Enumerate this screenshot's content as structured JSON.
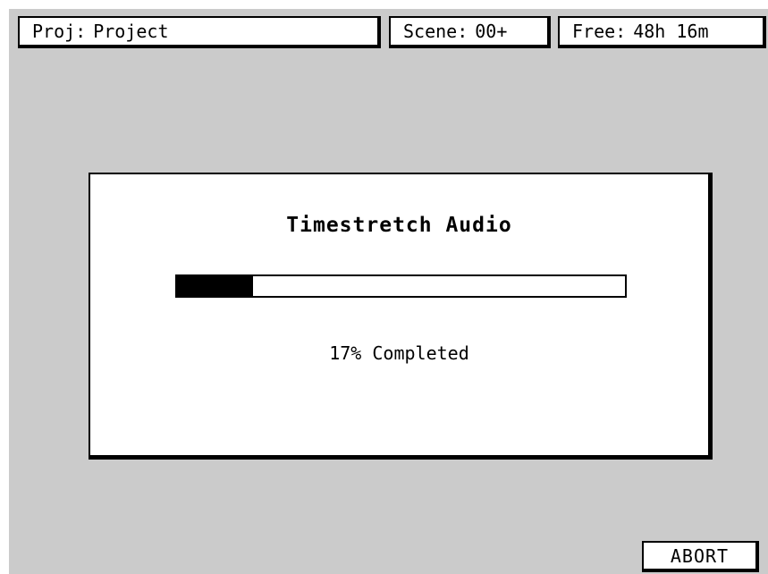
{
  "status": {
    "project": {
      "label": "Proj:",
      "value": "Project"
    },
    "scene": {
      "label": "Scene:",
      "value": "00+"
    },
    "free": {
      "label": "Free:",
      "value": "48h 16m"
    }
  },
  "dialog": {
    "title": "Timestretch Audio",
    "progress_percent": 17,
    "progress_label": "17% Completed"
  },
  "actions": {
    "abort_label": "ABORT"
  },
  "colors": {
    "background": "#cbcbcb",
    "panel": "#ffffff",
    "ink": "#000000"
  }
}
